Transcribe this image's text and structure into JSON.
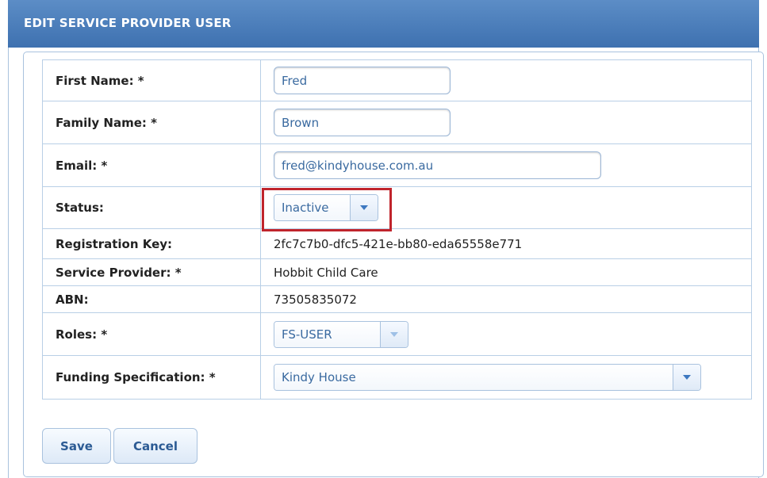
{
  "header": {
    "title": "EDIT SERVICE PROVIDER USER"
  },
  "fields": {
    "first_name": {
      "label": "First Name: *",
      "value": "Fred"
    },
    "family_name": {
      "label": "Family Name: *",
      "value": "Brown"
    },
    "email": {
      "label": "Email: *",
      "value": "fred@kindyhouse.com.au"
    },
    "status": {
      "label": "Status:",
      "selected": "Inactive"
    },
    "registration_key": {
      "label": "Registration Key:",
      "value": "2fc7c7b0-dfc5-421e-bb80-eda65558e771"
    },
    "service_provider": {
      "label": "Service Provider: *",
      "value": "Hobbit Child Care"
    },
    "abn": {
      "label": "ABN:",
      "value": "73505835072"
    },
    "roles": {
      "label": "Roles: *",
      "selected": "FS-USER"
    },
    "funding_specification": {
      "label": "Funding Specification: *",
      "selected": "Kindy House"
    }
  },
  "actions": {
    "save_label": "Save",
    "cancel_label": "Cancel"
  },
  "colors": {
    "header_bg": "#4a7fbe",
    "highlight": "#c0242c",
    "text_accent": "#3a6aa0"
  },
  "icons": {
    "dropdown": "chevron-down-icon"
  }
}
